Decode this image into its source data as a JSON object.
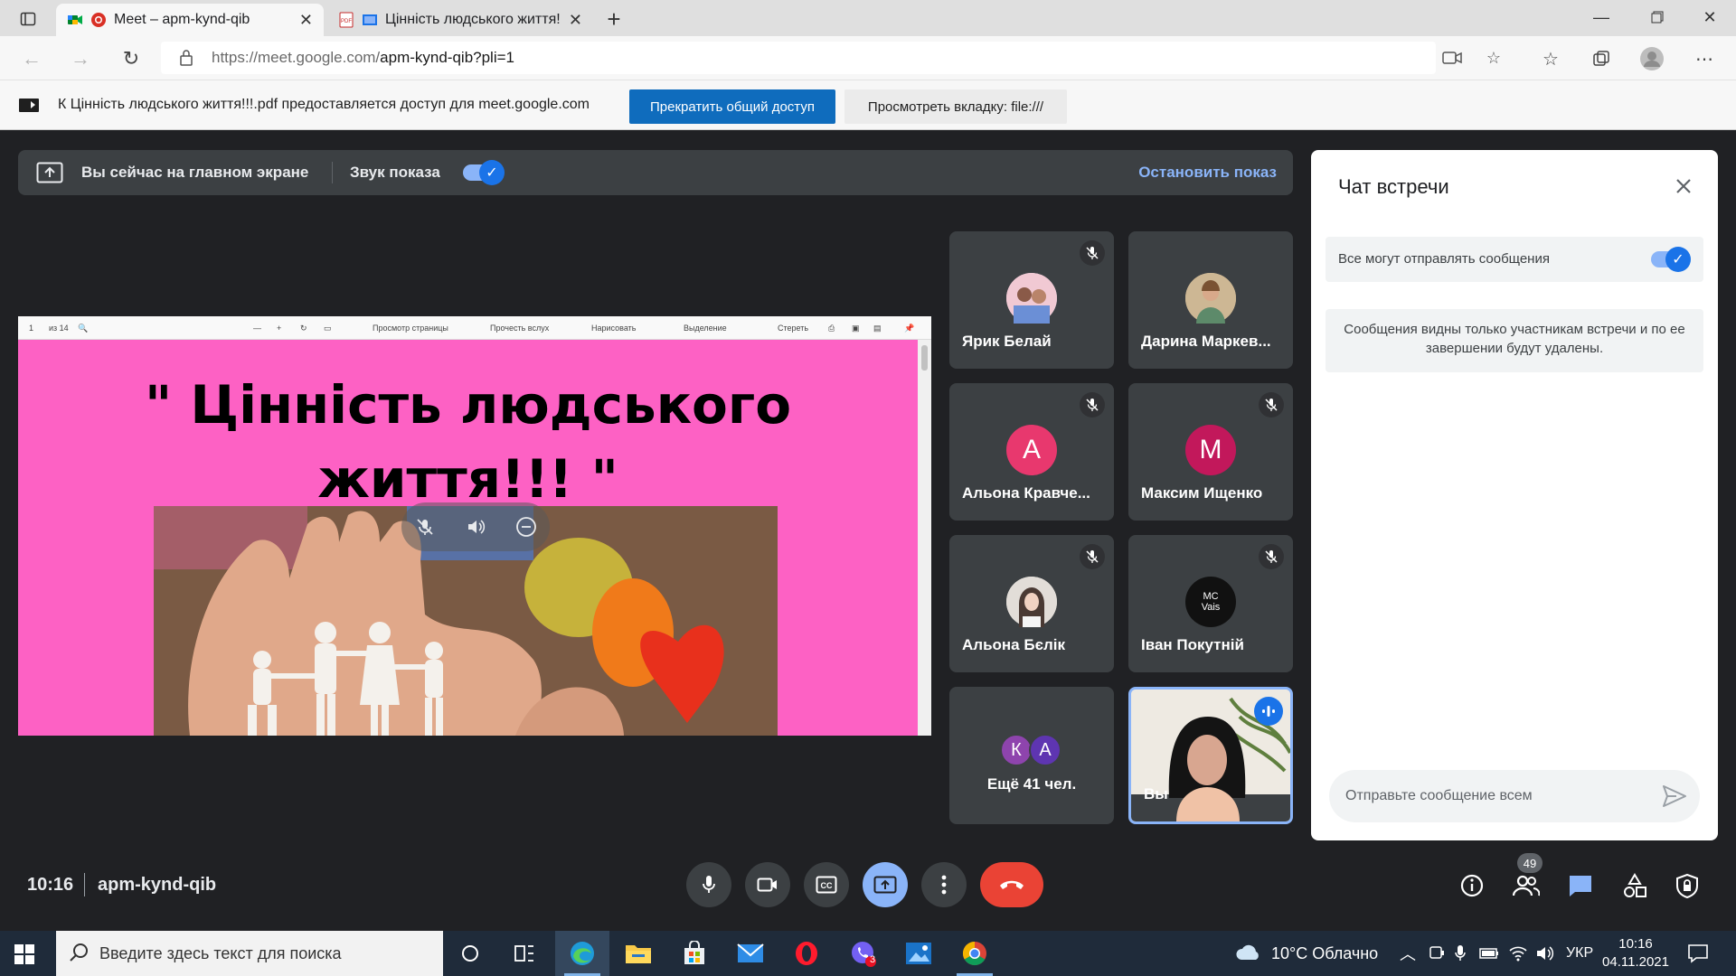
{
  "browser": {
    "tabs": [
      {
        "title": "Meet – apm-kynd-qib",
        "active": true
      },
      {
        "title": "Цінність людського життя!!!.pdf",
        "active": false
      }
    ],
    "url_base": "https://meet.google.com/",
    "url_path": "apm-kynd-qib?pli=1"
  },
  "infobar": {
    "message": "К Цінність людського життя!!!.pdf предоставляется доступ для meet.google.com",
    "stop_button": "Прекратить общий доступ",
    "view_tab_button": "Просмотреть вкладку: file:///"
  },
  "presenting": {
    "status": "Вы сейчас на главном экране",
    "sound_label": "Звук показа",
    "sound_on": true,
    "stop_label": "Остановить показ"
  },
  "shared_screen": {
    "pdf_toolbar": {
      "page": "1",
      "of_pages": "из 14",
      "page_view": "Просмотр страницы",
      "read_aloud": "Прочесть вслух",
      "draw": "Нарисовать",
      "highlight": "Выделение",
      "erase": "Стереть"
    },
    "slide_title_line1": "\" Цінність людського",
    "slide_title_line2": "життя!!! \""
  },
  "participants": [
    {
      "name": "Ярик Белай",
      "muted": true,
      "avatar": "photo"
    },
    {
      "name": "Дарина Маркев...",
      "muted": false,
      "avatar": "photo"
    },
    {
      "name": "Альона Кравче...",
      "muted": true,
      "avatar_letter": "А",
      "avatar_color": "#e8386e"
    },
    {
      "name": "Максим Ищенко",
      "muted": true,
      "avatar_letter": "М",
      "avatar_color": "#c2185b"
    },
    {
      "name": "Альона Бєлік",
      "muted": true,
      "avatar": "photo"
    },
    {
      "name": "Іван Покутній",
      "muted": true,
      "avatar": "logo",
      "avatar_text": "MC Vais"
    }
  ],
  "more_participants": {
    "letters": [
      "К",
      "А"
    ],
    "colors": [
      "#8e44ad",
      "#5e35b1"
    ],
    "label": "Ещё 41 чел."
  },
  "self_tile": {
    "name": "Вы",
    "speaking": true
  },
  "chat": {
    "title": "Чат встречи",
    "setting_label": "Все могут отправлять сообщения",
    "setting_on": true,
    "note": "Сообщения видны только участникам встречи и по ее завершении будут удалены.",
    "input_placeholder": "Отправьте сообщение всем"
  },
  "meet_bar": {
    "time": "10:16",
    "meeting_code": "apm-kynd-qib",
    "participants_count": "49"
  },
  "taskbar": {
    "search_placeholder": "Введите здесь текст для поиска",
    "weather": "10°C Облачно",
    "language": "УКР",
    "time": "10:16",
    "date": "04.11.2021",
    "viber_badge": "3"
  },
  "colors": {
    "accent": "#1a73e8",
    "end_call": "#ea4335",
    "slide_bg": "#fd61c4",
    "stop_share_button": "#0f6cbd"
  }
}
